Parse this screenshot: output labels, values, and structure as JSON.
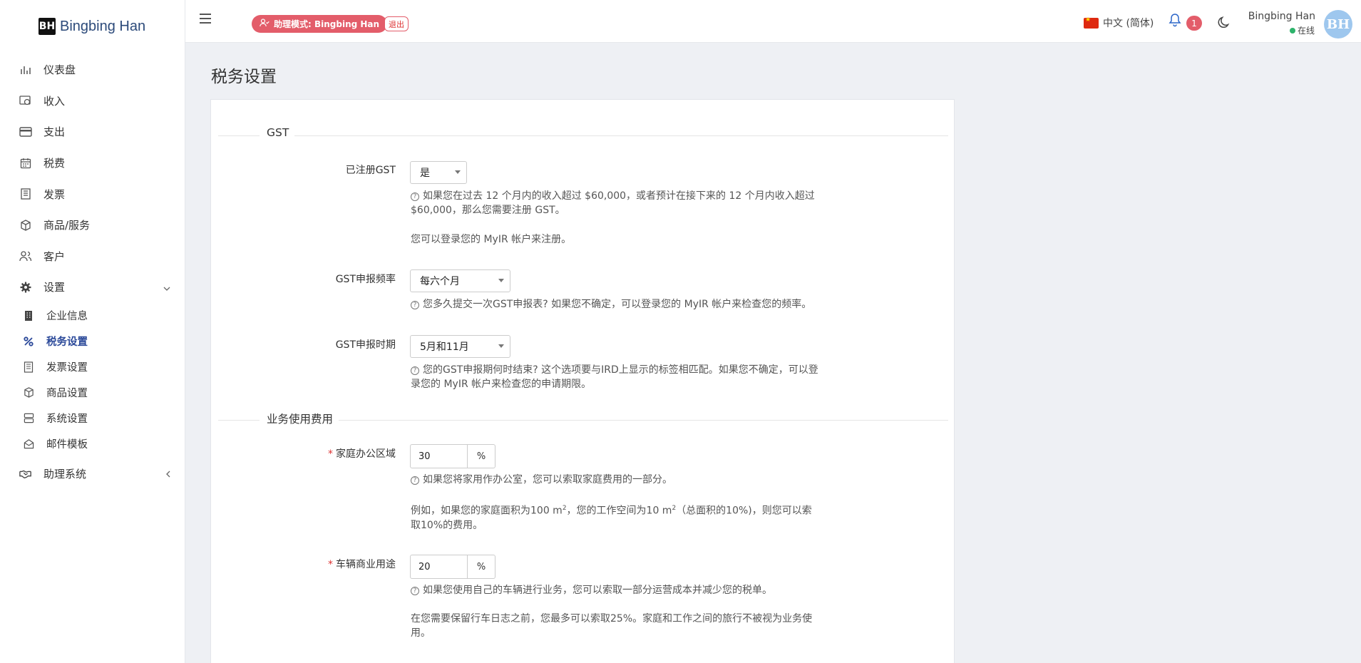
{
  "brand": {
    "logo": "BH",
    "name": "Bingbing Han"
  },
  "sidebar": {
    "items": [
      {
        "label": "仪表盘",
        "icon": "bar-chart-icon"
      },
      {
        "label": "收入",
        "icon": "income-icon"
      },
      {
        "label": "支出",
        "icon": "credit-card-icon"
      },
      {
        "label": "税费",
        "icon": "calendar-icon"
      },
      {
        "label": "发票",
        "icon": "receipt-icon"
      },
      {
        "label": "商品/服务",
        "icon": "box-icon"
      },
      {
        "label": "客户",
        "icon": "users-icon"
      },
      {
        "label": "设置",
        "icon": "gear-icon"
      }
    ],
    "settings_sub": [
      {
        "label": "企业信息",
        "icon": "building-icon"
      },
      {
        "label": "税务设置",
        "icon": "percent-icon"
      },
      {
        "label": "发票设置",
        "icon": "receipt-icon"
      },
      {
        "label": "商品设置",
        "icon": "box-icon"
      },
      {
        "label": "系统设置",
        "icon": "server-icon"
      },
      {
        "label": "邮件模板",
        "icon": "envelope-open-icon"
      }
    ],
    "assist": {
      "label": "助理系统",
      "icon": "handshake-icon"
    }
  },
  "topbar": {
    "assist_mode": "助理模式: Bingbing Han",
    "exit": "退出",
    "language": "中文 (简体)",
    "notifications": "1",
    "user_name": "Bingbing Han",
    "user_status": "在线",
    "avatar": "BH"
  },
  "page": {
    "title": "税务设置",
    "sections": {
      "gst": "GST",
      "business": "业务使用费用"
    },
    "gst_registered": {
      "label": "已注册GST",
      "value": "是",
      "help1": "如果您在过去 12 个月内的收入超过 $60,000，或者预计在接下来的 12 个月内收入超过 $60,000，那么您需要注册 GST。",
      "help2": "您可以登录您的 MyIR 帐户来注册。"
    },
    "gst_frequency": {
      "label": "GST申报频率",
      "value": "每六个月",
      "help": "您多久提交一次GST申报表? 如果您不确定，可以登录您的 MyIR 帐户来检查您的频率。"
    },
    "gst_period": {
      "label": "GST申报时期",
      "value": "5月和11月",
      "help": "您的GST申报期何时结束? 这个选项要与IRD上显示的标签相匹配。如果您不确定，可以登录您的 MyIR 帐户来检查您的申请期限。"
    },
    "home_office": {
      "label": "家庭办公区域",
      "value": "30",
      "unit": "%",
      "help1": "如果您将家用作办公室，您可以索取家庭费用的一部分。",
      "help2_a": "例如，如果您的家庭面积为100 m",
      "help2_b": "，您的工作空间为10 m",
      "help2_c": "（总面积的10%)，则您可以索取10%的费用。",
      "sup": "2"
    },
    "vehicle": {
      "label": "车辆商业用途",
      "value": "20",
      "unit": "%",
      "help1": "如果您使用自己的车辆进行业务，您可以索取一部分运营成本并减少您的税单。",
      "help2": "在您需要保留行车日志之前，您最多可以索取25%。家庭和工作之间的旅行不被视为业务使用。"
    }
  }
}
